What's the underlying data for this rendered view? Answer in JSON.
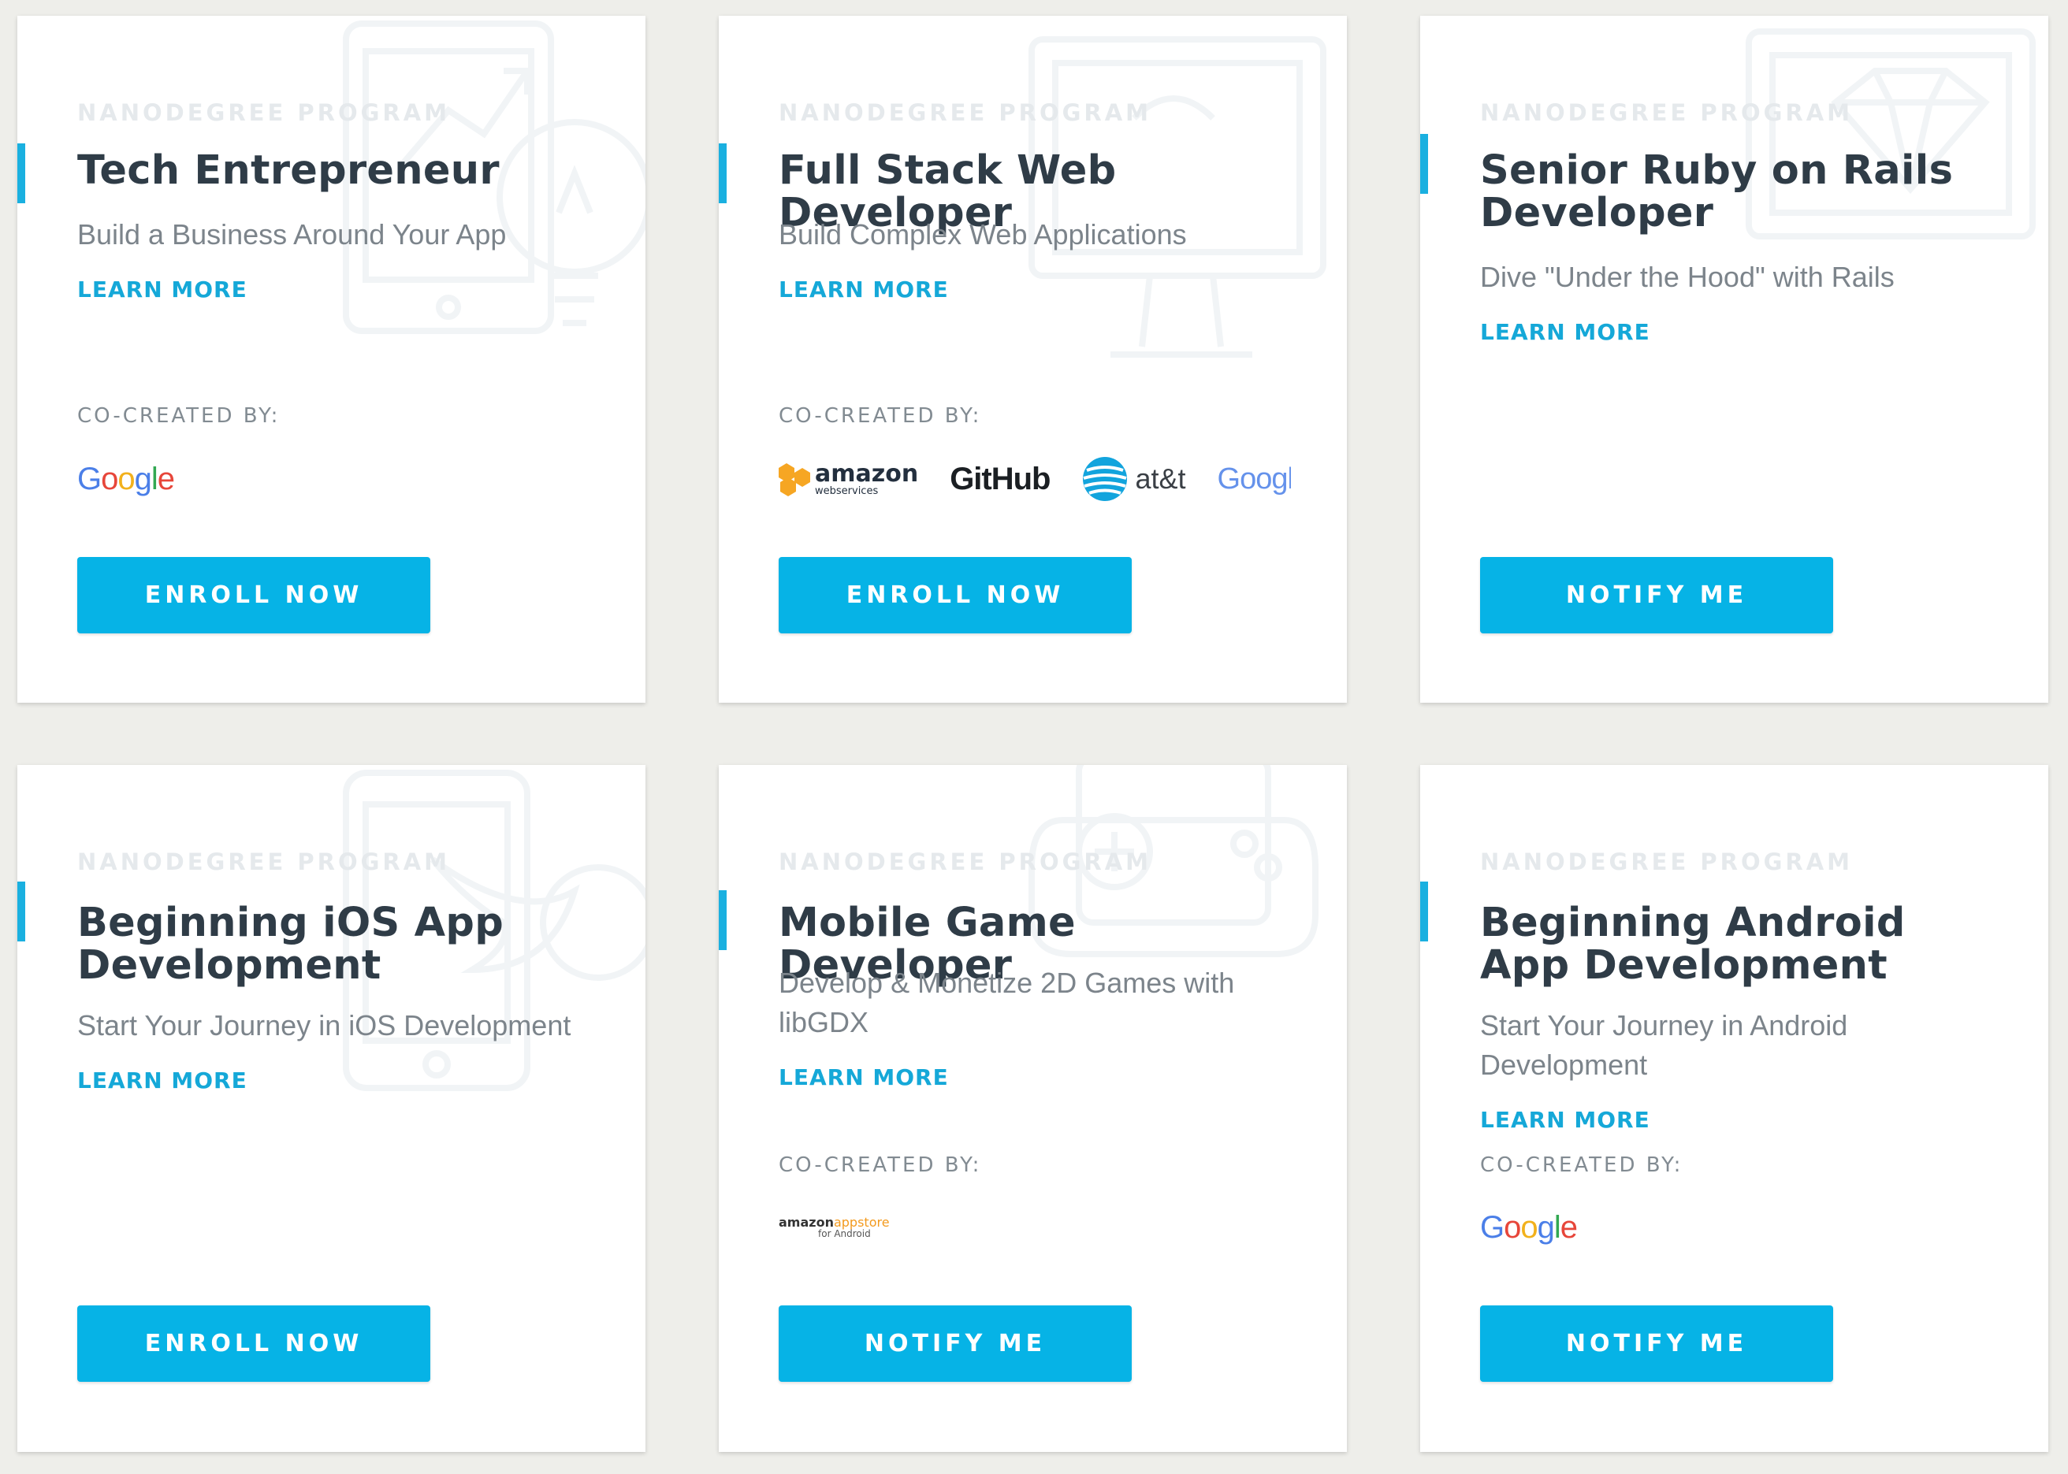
{
  "colors": {
    "accent": "#1ab0e0",
    "button": "#06b3e6",
    "link": "#15a8d8",
    "title": "#2f3c47",
    "page_bg": "#eeeeea"
  },
  "cards": [
    {
      "eyebrow": "NANODEGREE PROGRAM",
      "title": "Tech Entrepreneur",
      "subtitle": "Build a Business Around Your App",
      "learn_more": "LEARN MORE",
      "cocreated_label": "CO-CREATED BY:",
      "partners": {
        "google": "Google"
      },
      "button": "ENROLL NOW",
      "background_icon": "tablet-lightbulb-icon"
    },
    {
      "eyebrow": "NANODEGREE PROGRAM",
      "title": "Full Stack Web Developer",
      "subtitle": "Build Complex Web Applications",
      "learn_more": "LEARN MORE",
      "cocreated_label": "CO-CREATED BY:",
      "partners": {
        "amazon": "amazon",
        "amazon_sub": "webservices",
        "github": "GitHub",
        "att": "at&t",
        "google": "Googl"
      },
      "button": "ENROLL NOW",
      "background_icon": "monitor-icon"
    },
    {
      "eyebrow": "NANODEGREE PROGRAM",
      "title": "Senior Ruby on Rails Developer",
      "subtitle": "Dive \"Under the Hood\" with Rails",
      "learn_more": "LEARN MORE",
      "button": "NOTIFY ME",
      "background_icon": "ruby-gem-icon"
    },
    {
      "eyebrow": "NANODEGREE PROGRAM",
      "title": "Beginning iOS App Development",
      "subtitle": "Start Your Journey in iOS Development",
      "learn_more": "LEARN MORE",
      "button": "ENROLL NOW",
      "background_icon": "phone-swift-icon"
    },
    {
      "eyebrow": "NANODEGREE PROGRAM",
      "title": "Mobile Game Developer",
      "subtitle": "Develop & Monetize 2D Games with libGDX",
      "learn_more": "LEARN MORE",
      "cocreated_label": "CO-CREATED BY:",
      "partners": {
        "amazon": "amazon",
        "appstore": "appstore",
        "appstore_sub": "for Android"
      },
      "button": "NOTIFY ME",
      "background_icon": "gamepad-icon"
    },
    {
      "eyebrow": "NANODEGREE PROGRAM",
      "title": "Beginning Android App Development",
      "subtitle": "Start Your Journey in Android Development",
      "learn_more": "LEARN MORE",
      "cocreated_label": "CO-CREATED BY:",
      "partners": {
        "google": "Google"
      },
      "button": "NOTIFY ME"
    }
  ]
}
